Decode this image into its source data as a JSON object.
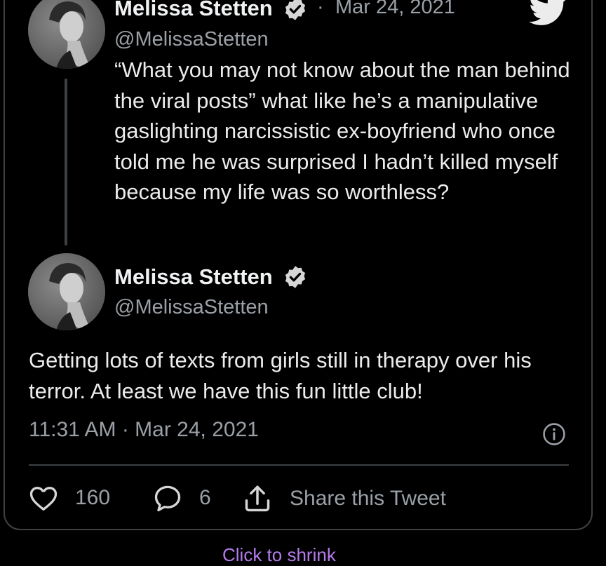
{
  "quoted_tweet": {
    "author_name": "Melissa Stetten",
    "handle": "@MelissaStetten",
    "date_separator": "·",
    "date": "Mar 24, 2021",
    "text": "“What you may not know about the man behind the viral posts” what like he’s a manipulative gaslighting narcissistic ex-boyfriend who once told me he was surprised I hadn’t killed myself because my life was so worthless?"
  },
  "main_tweet": {
    "author_name": "Melissa Stetten",
    "handle": "@MelissaStetten",
    "text": "Getting lots of texts from girls still in therapy over his terror. At least we have this fun little club!",
    "timestamp": "11:31 AM · Mar 24, 2021"
  },
  "actions": {
    "like_count": "160",
    "reply_count": "6",
    "share_label": "Share this Tweet"
  },
  "footer": {
    "shrink_link": "Click to shrink"
  },
  "icons": {
    "brand": "twitter-bird-icon",
    "verified": "verified-badge-icon",
    "info": "info-icon",
    "like": "heart-icon",
    "reply": "speech-bubble-icon",
    "share": "share-icon"
  },
  "colors": {
    "background": "#000000",
    "text_primary": "#ececec",
    "text_secondary": "#9aa0a6",
    "border": "#3e4144",
    "link": "#b47bea"
  }
}
